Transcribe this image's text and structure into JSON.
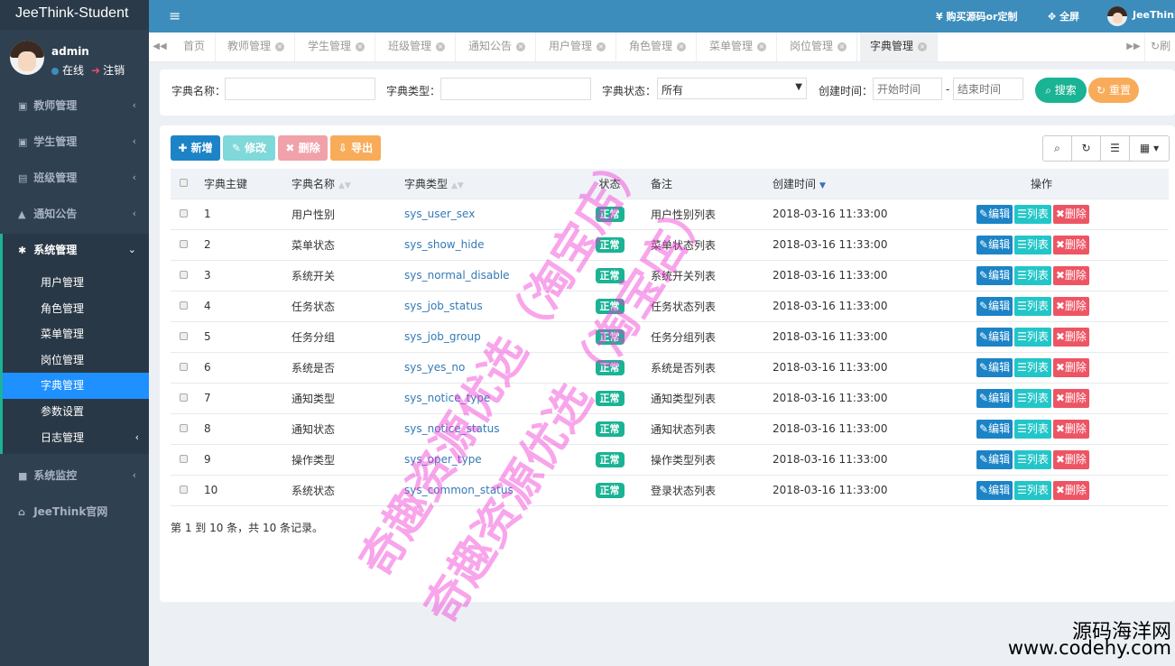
{
  "app": {
    "brand": "JeeThink-Student"
  },
  "user": {
    "name": "admin",
    "status": "在线",
    "logout": "注销"
  },
  "sidebar": {
    "items": [
      {
        "label": "教师管理",
        "icon": "id-card-icon"
      },
      {
        "label": "学生管理",
        "icon": "id-card-icon"
      },
      {
        "label": "班级管理",
        "icon": "address-card-icon"
      },
      {
        "label": "通知公告",
        "icon": "bell-icon"
      },
      {
        "label": "系统管理",
        "icon": "gear-icon"
      }
    ],
    "sub": [
      "用户管理",
      "角色管理",
      "菜单管理",
      "岗位管理",
      "字典管理",
      "参数设置",
      "日志管理"
    ],
    "monitor": "系统监控",
    "site": "JeeThink官网"
  },
  "topbar": {
    "buy": "¥ 购买源码or定制",
    "fullscreen": "全屏",
    "user": "JeeThink"
  },
  "tabs": [
    "首页",
    "教师管理",
    "学生管理",
    "班级管理",
    "通知公告",
    "用户管理",
    "角色管理",
    "菜单管理",
    "岗位管理",
    "字典管理"
  ],
  "tab_refresh": "刷",
  "search": {
    "dict_name_label": "字典名称：",
    "dict_type_label": "字典类型：",
    "dict_status_label": "字典状态：",
    "dict_status_value": "所有",
    "create_time_label": "创建时间：",
    "start_placeholder": "开始时间",
    "sep": "-",
    "end_placeholder": "结束时间",
    "search_btn": "搜索",
    "reset_btn": "重置"
  },
  "toolbar": {
    "add": "新增",
    "edit": "修改",
    "delete": "删除",
    "export": "导出"
  },
  "colors": {
    "add": "#1c84c6",
    "edit": "#7fd8d9",
    "delete": "#f1a1a9",
    "export": "#f8ac59",
    "search": "#1ab394",
    "reset": "#f8ac59"
  },
  "table": {
    "headers": {
      "key": "字典主键",
      "name": "字典名称",
      "type": "字典类型",
      "status": "状态",
      "remark": "备注",
      "created": "创建时间",
      "ops": "操作"
    },
    "rows": [
      {
        "id": "1",
        "name": "用户性别",
        "type": "sys_user_sex",
        "status": "正常",
        "remark": "用户性别列表",
        "created": "2018-03-16 11:33:00"
      },
      {
        "id": "2",
        "name": "菜单状态",
        "type": "sys_show_hide",
        "status": "正常",
        "remark": "菜单状态列表",
        "created": "2018-03-16 11:33:00"
      },
      {
        "id": "3",
        "name": "系统开关",
        "type": "sys_normal_disable",
        "status": "正常",
        "remark": "系统开关列表",
        "created": "2018-03-16 11:33:00"
      },
      {
        "id": "4",
        "name": "任务状态",
        "type": "sys_job_status",
        "status": "正常",
        "remark": "任务状态列表",
        "created": "2018-03-16 11:33:00"
      },
      {
        "id": "5",
        "name": "任务分组",
        "type": "sys_job_group",
        "status": "正常",
        "remark": "任务分组列表",
        "created": "2018-03-16 11:33:00"
      },
      {
        "id": "6",
        "name": "系统是否",
        "type": "sys_yes_no",
        "status": "正常",
        "remark": "系统是否列表",
        "created": "2018-03-16 11:33:00"
      },
      {
        "id": "7",
        "name": "通知类型",
        "type": "sys_notice_type",
        "status": "正常",
        "remark": "通知类型列表",
        "created": "2018-03-16 11:33:00"
      },
      {
        "id": "8",
        "name": "通知状态",
        "type": "sys_notice_status",
        "status": "正常",
        "remark": "通知状态列表",
        "created": "2018-03-16 11:33:00"
      },
      {
        "id": "9",
        "name": "操作类型",
        "type": "sys_oper_type",
        "status": "正常",
        "remark": "操作类型列表",
        "created": "2018-03-16 11:33:00"
      },
      {
        "id": "10",
        "name": "系统状态",
        "type": "sys_common_status",
        "status": "正常",
        "remark": "登录状态列表",
        "created": "2018-03-16 11:33:00"
      }
    ],
    "actions": {
      "edit": "编辑",
      "list": "列表",
      "delete": "删除"
    }
  },
  "pager": "第 1 到 10 条，共 10 条记录。",
  "watermark": {
    "line1": "奇趣资源优选（淘宝店）",
    "line2": "奇趣资源优选（淘宝店）"
  },
  "corner": {
    "line1": "源码海洋网",
    "line2": "www.codehy.com"
  }
}
